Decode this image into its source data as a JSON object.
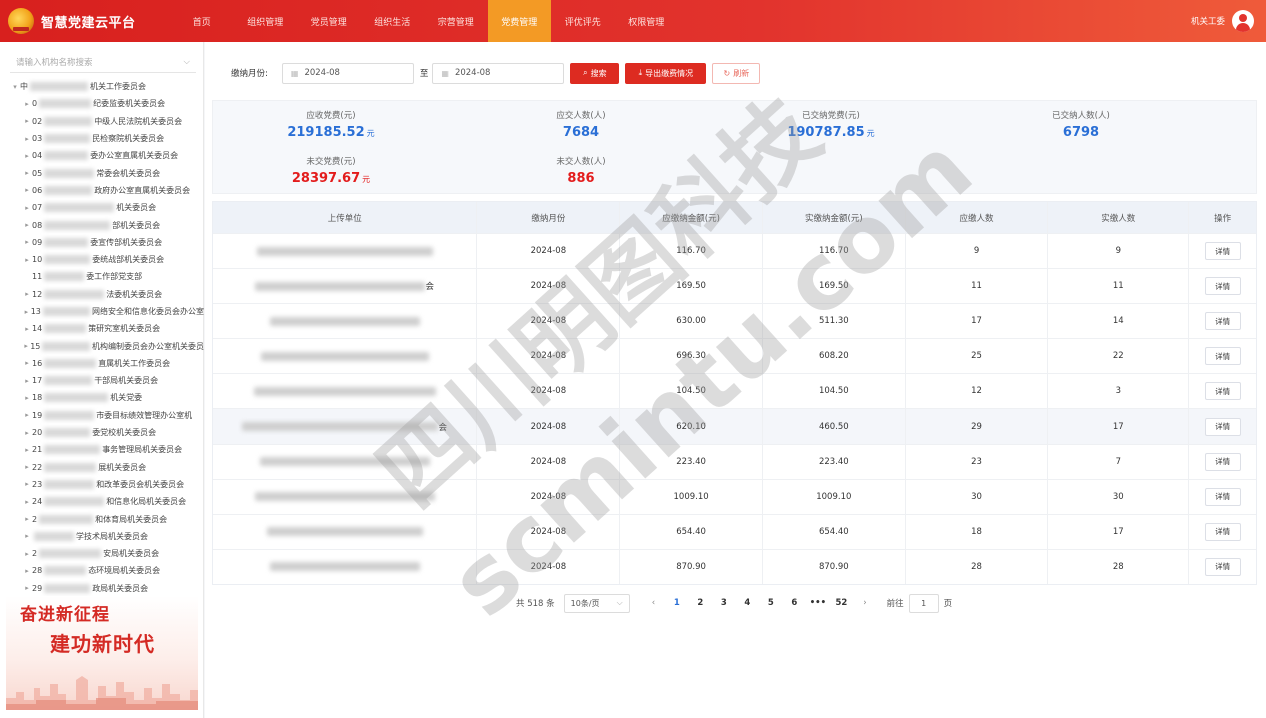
{
  "header": {
    "app_title": "智慧党建云平台",
    "nav": [
      "首页",
      "组织管理",
      "党员管理",
      "组织生活",
      "宗营管理",
      "党费管理",
      "评优评先",
      "权限管理"
    ],
    "active_index": 5,
    "user_name": "机关工委"
  },
  "sidebar": {
    "search_placeholder": "请输入机构名称搜索",
    "tree": [
      {
        "prefix": "中",
        "suffix": "机关工作委员会",
        "expandable": true,
        "expanded": true
      },
      {
        "prefix": "0",
        "suffix": "纪委监委机关委员会",
        "expandable": true
      },
      {
        "prefix": "02",
        "suffix": "中级人民法院机关委员会",
        "expandable": true
      },
      {
        "prefix": "03",
        "suffix": "民检察院机关委员会",
        "expandable": true
      },
      {
        "prefix": "04",
        "suffix": "委办公室直属机关委员会",
        "expandable": true
      },
      {
        "prefix": "05",
        "suffix": "常委会机关委员会",
        "expandable": true
      },
      {
        "prefix": "06",
        "suffix": "政府办公室直属机关委员会",
        "expandable": true
      },
      {
        "prefix": "07",
        "suffix": "机关委员会",
        "expandable": true
      },
      {
        "prefix": "08",
        "suffix": "部机关委员会",
        "expandable": true
      },
      {
        "prefix": "09",
        "suffix": "委宣传部机关委员会",
        "expandable": true
      },
      {
        "prefix": "10",
        "suffix": "委统战部机关委员会",
        "expandable": true
      },
      {
        "prefix": "11",
        "suffix": "委工作部党支部",
        "expandable": false
      },
      {
        "prefix": "12",
        "suffix": "法委机关委员会",
        "expandable": true
      },
      {
        "prefix": "13",
        "suffix": "网络安全和信息化委员会办公室",
        "expandable": true
      },
      {
        "prefix": "14",
        "suffix": "策研究室机关委员会",
        "expandable": true
      },
      {
        "prefix": "15",
        "suffix": "机构编制委员会办公室机关委员",
        "expandable": true
      },
      {
        "prefix": "16",
        "suffix": "直属机关工作委员会",
        "expandable": true
      },
      {
        "prefix": "17",
        "suffix": "干部局机关委员会",
        "expandable": true
      },
      {
        "prefix": "18",
        "suffix": "机关党委",
        "expandable": true
      },
      {
        "prefix": "19",
        "suffix": "市委目标绩效管理办公室机",
        "expandable": true
      },
      {
        "prefix": "20",
        "suffix": "委党校机关委员会",
        "expandable": true
      },
      {
        "prefix": "21",
        "suffix": "事务管理局机关委员会",
        "expandable": true
      },
      {
        "prefix": "22",
        "suffix": "展机关委员会",
        "expandable": true
      },
      {
        "prefix": "23",
        "suffix": "和改革委员会机关委员会",
        "expandable": true
      },
      {
        "prefix": "24",
        "suffix": "和信息化局机关委员会",
        "expandable": true
      },
      {
        "prefix": "2",
        "suffix": "和体育局机关委员会",
        "expandable": true
      },
      {
        "prefix": "",
        "suffix": "学技术局机关委员会",
        "expandable": true
      },
      {
        "prefix": "2",
        "suffix": "安局机关委员会",
        "expandable": true
      },
      {
        "prefix": "28",
        "suffix": "态环境局机关委员会",
        "expandable": true
      },
      {
        "prefix": "29",
        "suffix": "政局机关委员会",
        "expandable": true
      }
    ],
    "banner_line1": "奋进新征程",
    "banner_line2": "建功新时代"
  },
  "filter": {
    "label": "缴纳月份:",
    "start_date": "2024-08",
    "to_label": "至",
    "end_date": "2024-08",
    "search_label": "搜索",
    "export_label": "导出缴费情况",
    "refresh_label": "刷新"
  },
  "stats": [
    {
      "label": "应收党费(元)",
      "value": "219185.52",
      "unit": "元",
      "color": "blue"
    },
    {
      "label": "应交人数(人)",
      "value": "7684",
      "unit": "",
      "color": "blue"
    },
    {
      "label": "已交纳党费(元)",
      "value": "190787.85",
      "unit": "元",
      "color": "blue"
    },
    {
      "label": "已交纳人数(人)",
      "value": "6798",
      "unit": "",
      "color": "blue"
    },
    {
      "label": "未交党费(元)",
      "value": "28397.67",
      "unit": "元",
      "color": "red"
    },
    {
      "label": "未交人数(人)",
      "value": "886",
      "unit": "",
      "color": "red"
    }
  ],
  "table": {
    "headers": [
      "上传单位",
      "缴纳月份",
      "应缴纳金额(元)",
      "实缴纳金额(元)",
      "应缴人数",
      "实缴人数",
      "操作"
    ],
    "rows": [
      {
        "org_prefix": "",
        "org_suffix": "",
        "month": "2024-08",
        "due": "116.70",
        "paid": "116.70",
        "due_count": "9",
        "paid_count": "9"
      },
      {
        "org_prefix": "",
        "org_suffix": "会",
        "month": "2024-08",
        "due": "169.50",
        "paid": "169.50",
        "due_count": "11",
        "paid_count": "11"
      },
      {
        "org_prefix": "",
        "org_suffix": "",
        "month": "2024-08",
        "due": "630.00",
        "paid": "511.30",
        "due_count": "17",
        "paid_count": "14"
      },
      {
        "org_prefix": "",
        "org_suffix": "",
        "month": "2024-08",
        "due": "696.30",
        "paid": "608.20",
        "due_count": "25",
        "paid_count": "22"
      },
      {
        "org_prefix": "",
        "org_suffix": "",
        "month": "2024-08",
        "due": "104.50",
        "paid": "104.50",
        "due_count": "12",
        "paid_count": "3"
      },
      {
        "org_prefix": "",
        "org_suffix": "会",
        "month": "2024-08",
        "due": "620.10",
        "paid": "460.50",
        "due_count": "29",
        "paid_count": "17"
      },
      {
        "org_prefix": "",
        "org_suffix": "",
        "month": "2024-08",
        "due": "223.40",
        "paid": "223.40",
        "due_count": "23",
        "paid_count": "7"
      },
      {
        "org_prefix": "",
        "org_suffix": "",
        "month": "2024-08",
        "due": "1009.10",
        "paid": "1009.10",
        "due_count": "30",
        "paid_count": "30"
      },
      {
        "org_prefix": "",
        "org_suffix": "",
        "month": "2024-08",
        "due": "654.40",
        "paid": "654.40",
        "due_count": "18",
        "paid_count": "17"
      },
      {
        "org_prefix": "",
        "org_suffix": "",
        "month": "2024-08",
        "due": "870.90",
        "paid": "870.90",
        "due_count": "28",
        "paid_count": "28"
      }
    ],
    "detail_label": "详情",
    "highlight_row": 5
  },
  "pagination": {
    "total": "共 518 条",
    "page_size": "10条/页",
    "pages": [
      "1",
      "2",
      "3",
      "4",
      "5",
      "6",
      "•••",
      "52"
    ],
    "current": "1",
    "goto_label": "前往",
    "goto_value": "1",
    "page_suffix": "页"
  },
  "watermark": {
    "line1": "四川明图科技",
    "line2": "scmintu.com"
  },
  "colors": {
    "primary": "#dd2b21",
    "active_nav": "#f39a25",
    "value_blue": "#2a6fd6",
    "value_red": "#e31c1c"
  }
}
